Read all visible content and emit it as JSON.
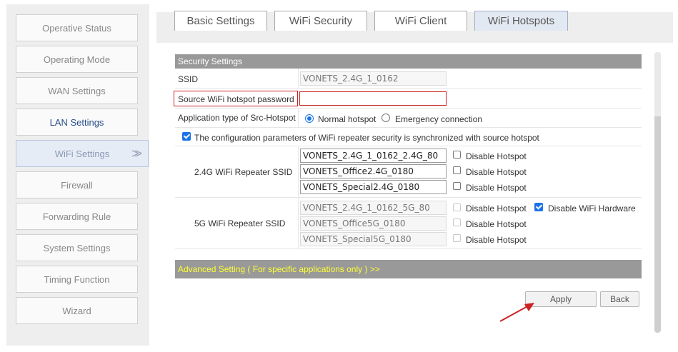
{
  "nav": {
    "items": [
      {
        "label": "Operative Status"
      },
      {
        "label": "Operating Mode"
      },
      {
        "label": "WAN Settings"
      },
      {
        "label": "LAN Settings"
      },
      {
        "label": "WiFi Settings"
      },
      {
        "label": "Firewall"
      },
      {
        "label": "Forwarding Rule"
      },
      {
        "label": "System Settings"
      },
      {
        "label": "Timing Function"
      },
      {
        "label": "Wizard"
      }
    ],
    "active_marker": ">>"
  },
  "tabs": [
    {
      "label": "Basic Settings"
    },
    {
      "label": "WiFi Security"
    },
    {
      "label": "WiFi Client"
    },
    {
      "label": "WiFi Hotspots"
    }
  ],
  "security": {
    "header": "Security Settings",
    "ssid_label": "SSID",
    "ssid_value": "VONETS_2.4G_1_0162",
    "password_label": "Source WiFi hotspot password",
    "password_value": "",
    "apptype_label": "Application type of Src-Hotspot",
    "apptype_options": [
      "Normal hotspot",
      "Emergency connection"
    ],
    "apptype_selected": "Normal hotspot",
    "sync_label": "The configuration parameters of WiFi repeater security is synchronized with source hotspot",
    "sync_checked": true,
    "g24_label": "2.4G WiFi Repeater SSID",
    "g24_ssids": [
      "VONETS_2.4G_1_0162_2.4G_80",
      "VONETS_Office2.4G_0180",
      "VONETS_Special2.4G_0180"
    ],
    "g5_label": "5G WiFi Repeater SSID",
    "g5_ssids": [
      "VONETS_2.4G_1_0162_5G_80",
      "VONETS_Office5G_0180",
      "VONETS_Special5G_0180"
    ],
    "disable_hotspot_label": "Disable Hotspot",
    "disable_hardware_label": "Disable WiFi Hardware",
    "disable_hardware_checked": true
  },
  "advanced": {
    "label": "Advanced Setting ( For specific applications only ) >>"
  },
  "buttons": {
    "apply": "Apply",
    "back": "Back"
  },
  "colors": {
    "header_bg": "#999999",
    "advanced_text": "#ffff33",
    "highlight_border": "#cc2222",
    "accent": "#1a73e8"
  }
}
